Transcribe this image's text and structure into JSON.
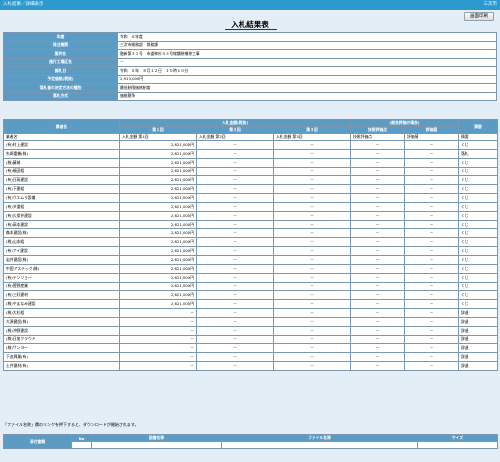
{
  "header": {
    "title": "入札結果／詳細表示",
    "right_link": "三次市"
  },
  "print_button": "画面印刷",
  "page_title": "入札結果表",
  "info": [
    {
      "label": "年度",
      "value": "令和　６年度"
    },
    {
      "label": "発注機関",
      "value": "三次市総務部　財務課"
    },
    {
      "label": "案件名",
      "value": "融新第３１号　市道神杉４３号線舗装補修工事"
    },
    {
      "label": "施行工場区名",
      "value": "－"
    },
    {
      "label": "開札日",
      "value": "令和　６年　８月１２日　１０時１０分"
    },
    {
      "label": "予定価格(税抜)",
      "value": "2,913,000円"
    },
    {
      "label": "落札者の決定方法の種別",
      "value": "最低制限価格制度"
    },
    {
      "label": "落札方式",
      "value": "価格競争"
    }
  ],
  "bids": {
    "headers": {
      "company": "業者名",
      "amounts_group": "入札金額(税抜)",
      "round1": "第１回",
      "round2": "第２回",
      "round3": "第３回",
      "eval_group": "(総合評価の場合)",
      "tech_score": "技術評価点",
      "eval_value": "評価値",
      "remarks": "摘要"
    },
    "subheaders": {
      "company": "業者名",
      "amt1": "入札金額 第1回",
      "amt2": "入札金額 第2回",
      "amt3": "入札金額 第3回",
      "tech": "技術評価点",
      "eval": "評価値",
      "remarks": "摘要"
    },
    "rows": [
      {
        "company": "(有)村上建設",
        "r1": "2,621,000円",
        "r2": "－",
        "r3": "－",
        "tech": "－",
        "eval": "－",
        "remarks": "くじ"
      },
      {
        "company": "矢崎重機(株)",
        "r1": "2,621,000円",
        "r2": "－",
        "r3": "－",
        "tech": "－",
        "eval": "－",
        "remarks": "落札"
      },
      {
        "company": "(株)藤城",
        "r1": "2,621,000円",
        "r2": "－",
        "r3": "－",
        "tech": "－",
        "eval": "－",
        "remarks": "くじ"
      },
      {
        "company": "(有)福田組",
        "r1": "2,621,000円",
        "r2": "－",
        "r3": "－",
        "tech": "－",
        "eval": "－",
        "remarks": "くじ"
      },
      {
        "company": "(有)日高建設",
        "r1": "2,621,000円",
        "r2": "－",
        "r3": "－",
        "tech": "－",
        "eval": "－",
        "remarks": "くじ"
      },
      {
        "company": "(有)下建組",
        "r1": "2,621,000円",
        "r2": "－",
        "r3": "－",
        "tech": "－",
        "eval": "－",
        "remarks": "くじ"
      },
      {
        "company": "(有)ウエムラ設備",
        "r1": "2,621,000円",
        "r2": "－",
        "r3": "－",
        "tech": "－",
        "eval": "－",
        "remarks": "くじ"
      },
      {
        "company": "(有)ダ道組",
        "r1": "2,621,000円",
        "r2": "－",
        "r3": "－",
        "tech": "－",
        "eval": "－",
        "remarks": "くじ"
      },
      {
        "company": "(有)久保井建設",
        "r1": "2,621,000円",
        "r2": "－",
        "r3": "－",
        "tech": "－",
        "eval": "－",
        "remarks": "くじ"
      },
      {
        "company": "(有)高本建設",
        "r1": "2,621,000円",
        "r2": "－",
        "r3": "－",
        "tech": "－",
        "eval": "－",
        "remarks": "くじ"
      },
      {
        "company": "森本建設(株)",
        "r1": "2,621,000円",
        "r2": "－",
        "r3": "－",
        "tech": "－",
        "eval": "－",
        "remarks": "くじ"
      },
      {
        "company": "(株)山本組",
        "r1": "2,621,000円",
        "r2": "－",
        "r3": "－",
        "tech": "－",
        "eval": "－",
        "remarks": "くじ"
      },
      {
        "company": "(有)アイ建設",
        "r1": "2,621,000円",
        "r2": "－",
        "r3": "－",
        "tech": "－",
        "eval": "－",
        "remarks": "くじ"
      },
      {
        "company": "岩井建設(株)",
        "r1": "2,621,000円",
        "r2": "－",
        "r3": "－",
        "tech": "－",
        "eval": "－",
        "remarks": "くじ"
      },
      {
        "company": "中国アステック(株)",
        "r1": "2,621,000円",
        "r2": "－",
        "r3": "－",
        "tech": "－",
        "eval": "－",
        "remarks": "くじ"
      },
      {
        "company": "(有)テンリョー",
        "r1": "2,621,000円",
        "r2": "－",
        "r3": "－",
        "tech": "－",
        "eval": "－",
        "remarks": "くじ"
      },
      {
        "company": "(有)菅野産業",
        "r1": "2,621,000円",
        "r2": "－",
        "r3": "－",
        "tech": "－",
        "eval": "－",
        "remarks": "くじ"
      },
      {
        "company": "(有)三好建材",
        "r1": "2,621,000円",
        "r2": "－",
        "r3": "－",
        "tech": "－",
        "eval": "－",
        "remarks": "くじ"
      },
      {
        "company": "(株)やまなみ建設",
        "r1": "2,621,000円",
        "r2": "－",
        "r3": "－",
        "tech": "－",
        "eval": "－",
        "remarks": "くじ"
      },
      {
        "company": "(株)大杉組",
        "r1": "－",
        "r2": "－",
        "r3": "－",
        "tech": "－",
        "eval": "－",
        "remarks": "辞退"
      },
      {
        "company": "大源建設(株)",
        "r1": "－",
        "r2": "－",
        "r3": "－",
        "tech": "－",
        "eval": "－",
        "remarks": "辞退"
      },
      {
        "company": "(株)沖野建設",
        "r1": "－",
        "r2": "－",
        "r3": "－",
        "tech": "－",
        "eval": "－",
        "remarks": "辞退"
      },
      {
        "company": "(株)日加クラウド",
        "r1": "－",
        "r2": "－",
        "r3": "－",
        "tech": "－",
        "eval": "－",
        "remarks": "辞退"
      },
      {
        "company": "(株)サンヨー",
        "r1": "－",
        "r2": "－",
        "r3": "－",
        "tech": "－",
        "eval": "－",
        "remarks": "辞退"
      },
      {
        "company": "下迫興業(有)",
        "r1": "－",
        "r2": "－",
        "r3": "－",
        "tech": "－",
        "eval": "－",
        "remarks": "辞退"
      },
      {
        "company": "土井建材(有)",
        "r1": "－",
        "r2": "－",
        "r3": "－",
        "tech": "－",
        "eval": "－",
        "remarks": "辞退"
      }
    ]
  },
  "note": "「ファイル名称」欄のリンクを押下すると、ダウンロードが開始されます。",
  "attachments": {
    "row_label": "添付書類",
    "headers": {
      "no": "No",
      "doc_name": "図書名称",
      "file_name": "ファイル名称",
      "size": "サイズ"
    }
  }
}
